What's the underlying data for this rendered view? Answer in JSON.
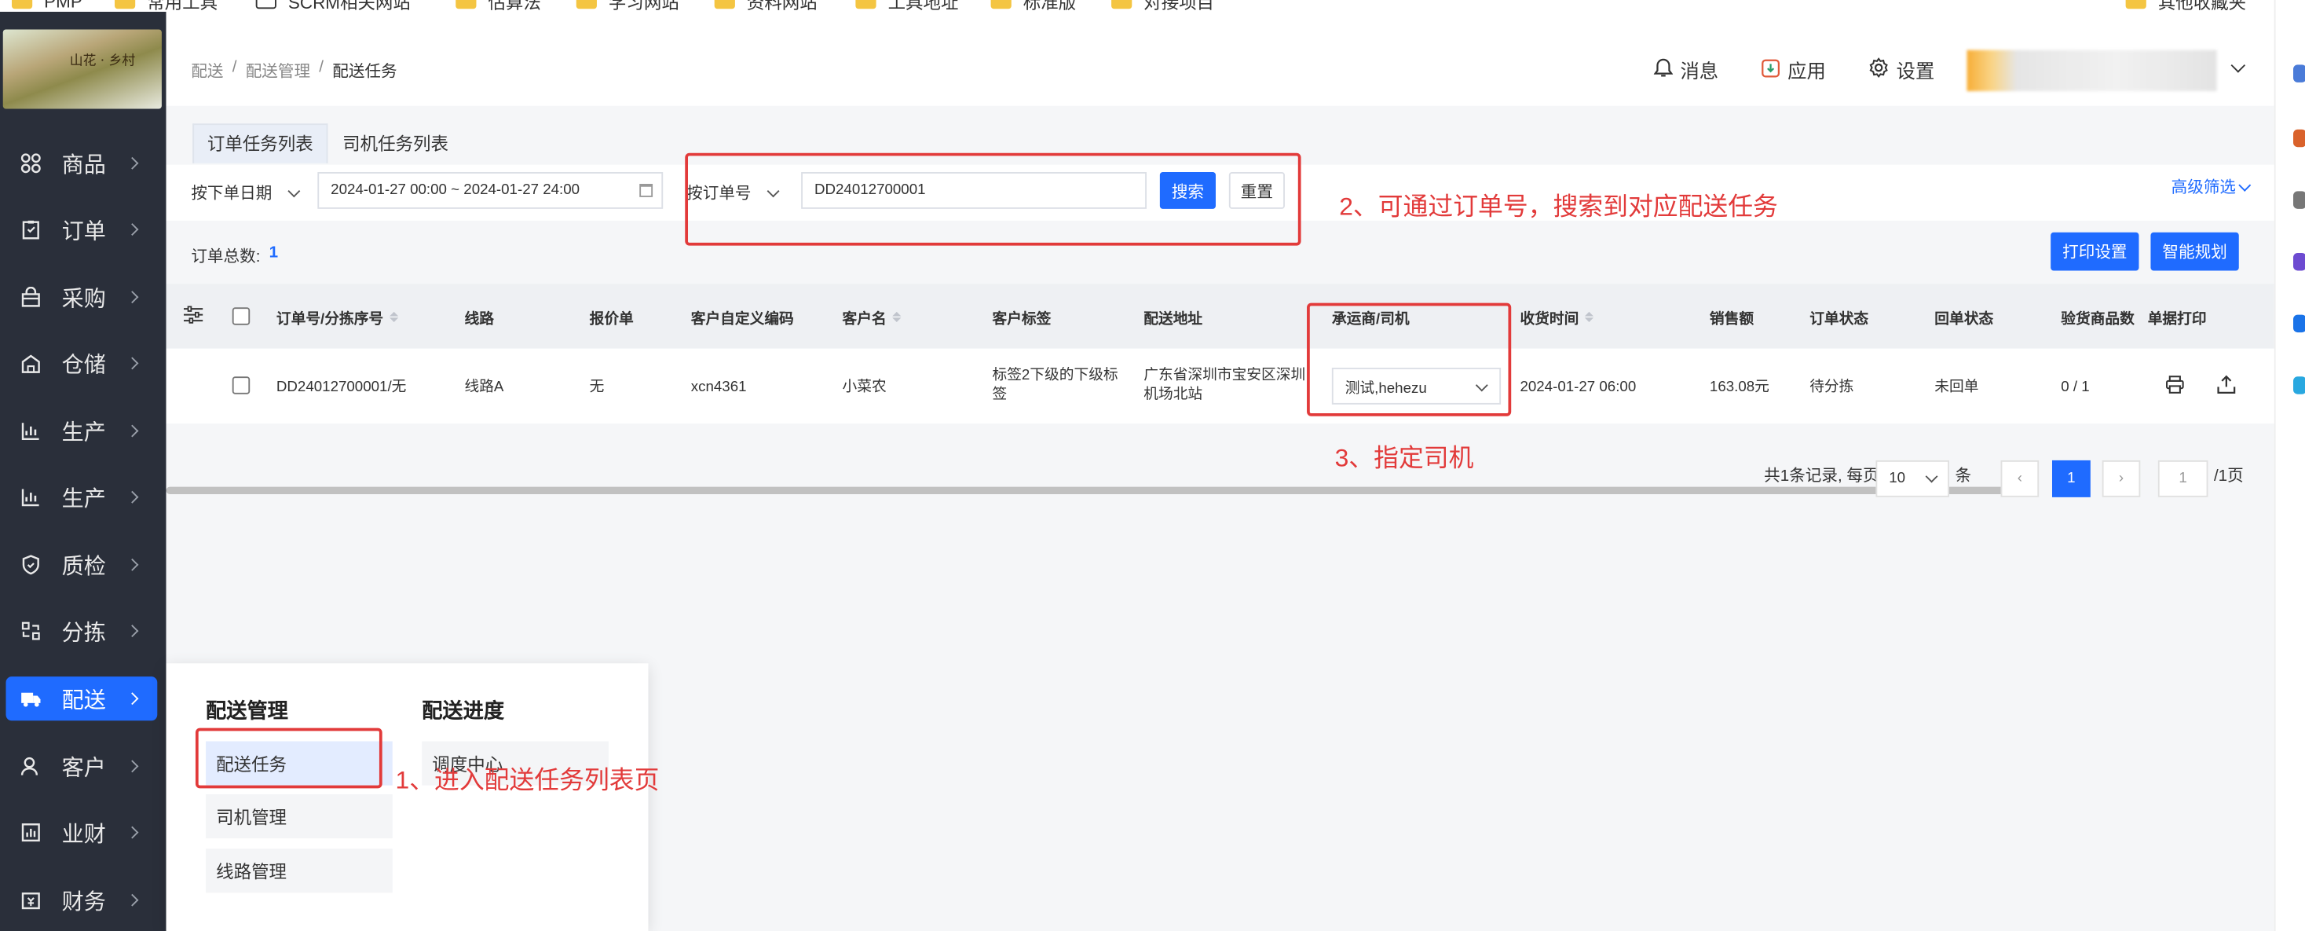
{
  "bookmarks": [
    "PMP",
    "常用工具",
    "SCRM相关网站",
    "估算法",
    "学习网站",
    "资料网站",
    "工具地址",
    "标准版",
    "对接项目",
    "其他收藏夹"
  ],
  "sidebar": {
    "items": [
      {
        "label": "商品"
      },
      {
        "label": "订单"
      },
      {
        "label": "采购"
      },
      {
        "label": "仓储"
      },
      {
        "label": "生产"
      },
      {
        "label": "生产"
      },
      {
        "label": "质检"
      },
      {
        "label": "分拣"
      },
      {
        "label": "配送"
      },
      {
        "label": "客户"
      },
      {
        "label": "业财"
      },
      {
        "label": "财务"
      }
    ]
  },
  "header": {
    "breadcrumb": [
      "配送",
      "配送管理",
      "配送任务"
    ],
    "messages": "消息",
    "apps": "应用",
    "settings": "设置"
  },
  "tabs": [
    "订单任务列表",
    "司机任务列表"
  ],
  "filters": {
    "date_type": "按下单日期",
    "date_range": "2024-01-27 00:00 ~ 2024-01-27 24:00",
    "search_type": "按订单号",
    "search_value": "DD24012700001",
    "search_btn": "搜索",
    "reset_btn": "重置",
    "advanced": "高级筛选"
  },
  "summary": {
    "label": "订单总数:",
    "count": "1"
  },
  "actions": {
    "print_settings": "打印设置",
    "smart_plan": "智能规划"
  },
  "table": {
    "headers": [
      "订单号/分拣序号",
      "线路",
      "报价单",
      "客户自定义编码",
      "客户名",
      "客户标签",
      "配送地址",
      "承运商/司机",
      "收货时间",
      "销售额",
      "订单状态",
      "回单状态",
      "验货商品数",
      "单据打印"
    ],
    "row": {
      "order_no": "DD24012700001/无",
      "route": "线路A",
      "quote": "无",
      "custom_code": "xcn4361",
      "customer": "小菜农",
      "tag": "标签2下级的下级标签",
      "address": "广东省深圳市宝安区深圳机场北站",
      "carrier": "测试,hehezu",
      "receive_time": "2024-01-27 06:00",
      "sales": "163.08元",
      "order_status": "待分拣",
      "receipt_status": "未回单",
      "checked": "0 / 1"
    }
  },
  "pagination": {
    "total": "共1条记录, 每页",
    "page_size": "10",
    "unit": "条",
    "current": "1",
    "jump": "1",
    "pages": "/1页"
  },
  "menu": {
    "group1_title": "配送管理",
    "group1_items": [
      "配送任务",
      "司机管理",
      "线路管理"
    ],
    "group2_title": "配送进度",
    "group2_items": [
      "调度中心"
    ]
  },
  "annotations": {
    "step1": "1、进入配送任务列表页",
    "step2": "2、可通过订单号，搜索到对应配送任务",
    "step3": "3、指定司机"
  },
  "colors": {
    "primary": "#1f6bff",
    "sidebar": "#2a2f3a",
    "annotation": "#e23a3a"
  }
}
